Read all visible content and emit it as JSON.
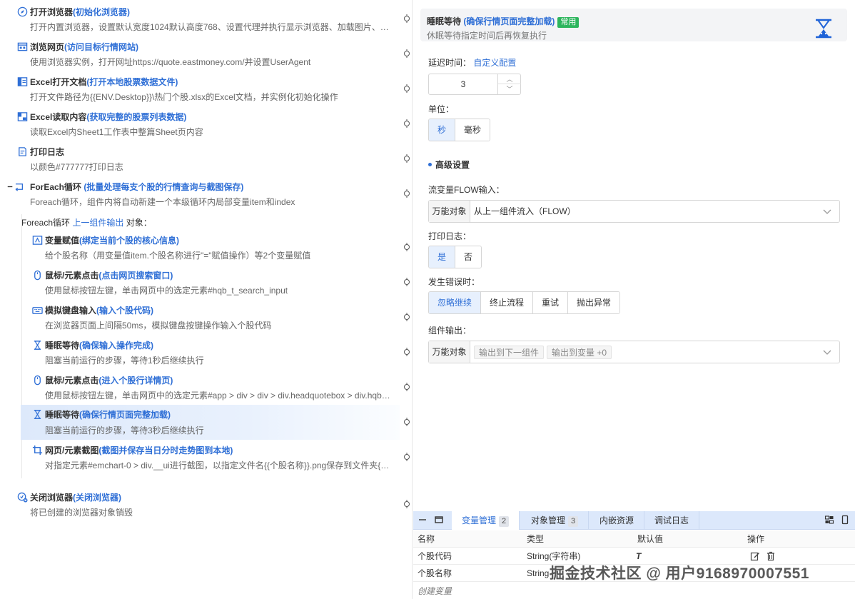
{
  "flow": {
    "steps": [
      {
        "name": "打开浏览器",
        "note": "(初始化浏览器)",
        "desc": "打开内置浏览器，设置默认宽度1024默认高度768、设置代理并执行显示浏览器、加载图片、…",
        "icon": "compass-icon"
      },
      {
        "name": "浏览网页",
        "note": "(访问目标行情网站)",
        "desc": "使用浏览器实例，打开网址https://quote.eastmoney.com/并设置UserAgent",
        "icon": "browser-window-icon"
      },
      {
        "name": "Excel打开文档",
        "note": "(打开本地股票数据文件)",
        "desc": "打开文件路径为{{ENV.Desktop}}\\热门个股.xlsx的Excel文档，并实例化初始化操作",
        "icon": "excel-open-icon"
      },
      {
        "name": "Excel读取内容",
        "note": "(获取完整的股票列表数据)",
        "desc": "读取Excel内Sheet1工作表中整篇Sheet页内容",
        "icon": "excel-read-icon"
      },
      {
        "name": "打印日志",
        "note": "",
        "desc": "以颜色#777777打印日志",
        "icon": "log-icon"
      },
      {
        "name": "ForEach循环",
        "note": "(批量处理每支个股的行情查询与截图保存)",
        "desc": "Foreach循环，组件内将自动新建一个本级循环内局部变量item和index",
        "icon": "loop-collapse-icon"
      },
      {
        "name": "变量赋值",
        "note": "(绑定当前个股的核心信息)",
        "desc": "给个股名称（用变量值item.个股名称进行\"=\"赋值操作）等2个变量赋值",
        "icon": "variable-assign-icon"
      },
      {
        "name": "鼠标/元素点击",
        "note": "(点击网页搜索窗口)",
        "desc": "使用鼠标按钮左键，单击网页中的选定元素#hqb_t_search_input",
        "icon": "mouse-icon"
      },
      {
        "name": "模拟键盘输入",
        "note": "(输入个股代码)",
        "desc": "在浏览器页面上间隔50ms，模拟键盘按键操作输入个股代码",
        "icon": "keyboard-icon"
      },
      {
        "name": "睡眠等待",
        "note": "(确保输入操作完成)",
        "desc": "阻塞当前运行的步骤，等待1秒后继续执行",
        "icon": "hourglass-icon"
      },
      {
        "name": "鼠标/元素点击",
        "note": "(进入个股行详情页)",
        "desc": "使用鼠标按钮左键，单击网页中的选定元素#app > div > div > div.headquotebox > div.hqb…",
        "icon": "mouse-icon"
      },
      {
        "name": "睡眠等待",
        "note": "(确保行情页面完整加载)",
        "desc": "阻塞当前运行的步骤，等待3秒后继续执行",
        "icon": "hourglass-icon"
      },
      {
        "name": "网页/元素截图",
        "note": "(截图并保存当日分时走势图到本地)",
        "desc": "对指定元素#emchart-0 > div.__ui进行截图，以指定文件名{{个股名称}}.png保存到文件夹{{…",
        "icon": "crop-icon"
      },
      {
        "name": "关闭浏览器",
        "note": "(关闭浏览器)",
        "desc": "将已创建的浏览器对象销毁",
        "icon": "close-browser-icon"
      }
    ],
    "loop_label_prefix": "Foreach循环",
    "loop_label_link": "上一组件输出",
    "loop_label_suffix": "对象："
  },
  "config": {
    "title": "睡眠等待",
    "title_note": "(确保行情页面完整加载)",
    "badge": "常用",
    "subtitle": "休眠等待指定时间后再恢复执行",
    "delay_label": "延迟时间：",
    "delay_link": "自定义配置",
    "delay_value": "3",
    "unit_label": "单位：",
    "unit_options": [
      "秒",
      "毫秒"
    ],
    "unit_selected": 0,
    "advanced_label": "高级设置",
    "flow_input_label": "流变量FLOW输入：",
    "flow_input_prefix": "万能对象",
    "flow_input_value": "从上一组件流入（FLOW）",
    "print_log_label": "打印日志：",
    "print_log_options": [
      "是",
      "否"
    ],
    "print_log_selected": 0,
    "on_error_label": "发生错误时：",
    "on_error_options": [
      "忽略继续",
      "终止流程",
      "重试",
      "抛出异常"
    ],
    "on_error_selected": 0,
    "output_label": "组件输出：",
    "output_prefix": "万能对象",
    "output_tags": [
      "输出到下一组件",
      "输出到变量 +0"
    ]
  },
  "bottom": {
    "tabs": [
      {
        "label": "变量管理",
        "count": "2"
      },
      {
        "label": "对象管理",
        "count": "3"
      },
      {
        "label": "内嵌资源",
        "count": ""
      },
      {
        "label": "调试日志",
        "count": ""
      }
    ],
    "columns": [
      "名称",
      "类型",
      "默认值",
      "操作"
    ],
    "rows": [
      {
        "name": "个股代码",
        "type": "String(字符串)",
        "default": "T"
      },
      {
        "name": "个股名称",
        "type": "String",
        "default": ""
      }
    ],
    "add_label": "创建变量"
  },
  "watermark": "掘金技术社区 @ 用户9168970007551"
}
